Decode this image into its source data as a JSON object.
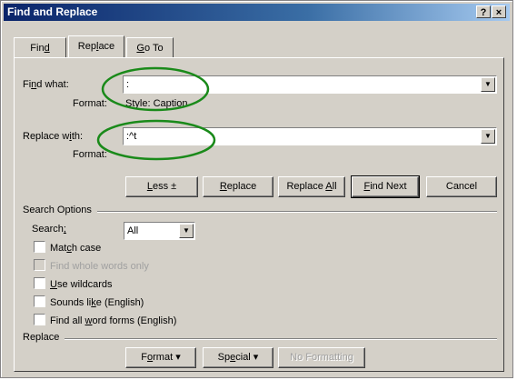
{
  "window": {
    "title": "Find and Replace",
    "help_label": "?",
    "close_label": "×"
  },
  "tabs": [
    {
      "pre": "Fin",
      "acc": "d",
      "post": ""
    },
    {
      "pre": "Rep",
      "acc": "l",
      "post": "ace"
    },
    {
      "pre": "",
      "acc": "G",
      "post": "o To"
    }
  ],
  "find": {
    "label_pre": "Fi",
    "label_acc": "n",
    "label_post": "d what:",
    "value": ":",
    "format_label": "Format:",
    "format_value": "Style: Caption"
  },
  "replace": {
    "label_pre": "Replace w",
    "label_acc": "i",
    "label_post": "th:",
    "value": ":^t",
    "format_label": "Format:"
  },
  "buttons": {
    "less_acc": "L",
    "less_post": "ess ±",
    "replace_acc": "R",
    "replace_post": "eplace",
    "replace_all_pre": "Replace ",
    "replace_all_acc": "A",
    "replace_all_post": "ll",
    "find_next_acc": "F",
    "find_next_post": "ind Next",
    "cancel": "Cancel"
  },
  "search_options": {
    "header": "Search Options",
    "search_pre": "Search",
    "search_acc": ";",
    "search_post": "",
    "search_value": "All",
    "checkboxes": [
      {
        "pre": "Mat",
        "acc": "c",
        "post": "h case"
      },
      {
        "pre": "Find whole words only",
        "acc": "",
        "post": ""
      },
      {
        "pre": "",
        "acc": "U",
        "post": "se wildcards"
      },
      {
        "pre": "Sounds li",
        "acc": "k",
        "post": "e (English)"
      },
      {
        "pre": "Find all ",
        "acc": "w",
        "post": "ord forms (English)"
      }
    ]
  },
  "replace_section": {
    "header": "Replace",
    "format_pre": "F",
    "format_acc": "o",
    "format_post": "rmat ▾",
    "special_pre": "Sp",
    "special_acc": "e",
    "special_post": "cial ▾",
    "no_formatting": "No Formatting"
  },
  "colors": {
    "annotation": "#1a8a1a"
  }
}
